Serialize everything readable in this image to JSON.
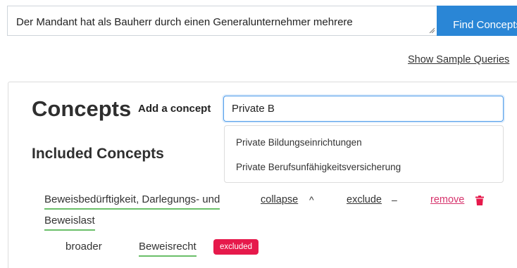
{
  "search": {
    "query_value": "Der Mandant hat als Bauherr durch einen Generalunternehmer mehrere",
    "find_button": "Find Concepts"
  },
  "sample_queries_link": "Show Sample Queries",
  "concepts_panel": {
    "title": "Concepts",
    "add_label": "Add a concept",
    "input_value": "Private B",
    "suggestions": [
      "Private Bildungseinrichtungen",
      "Private Berufsunfähigkeitsversicherung"
    ],
    "included_title": "Included Concepts",
    "included": [
      {
        "label_line1": "Beweisbedürftigkeit, Darlegungs- und",
        "label_line2": "Beweislast",
        "collapse_label": "collapse",
        "collapse_symbol": "^",
        "exclude_label": "exclude",
        "exclude_symbol": "–",
        "remove_label": "remove",
        "broader_label": "broader",
        "broader_term": "Beweisrecht",
        "broader_badge": "excluded"
      }
    ]
  },
  "colors": {
    "primary": "#2a86d6",
    "underline_green": "#6abf69",
    "remove_pink": "#d6336c",
    "badge_red": "#e6194b"
  }
}
